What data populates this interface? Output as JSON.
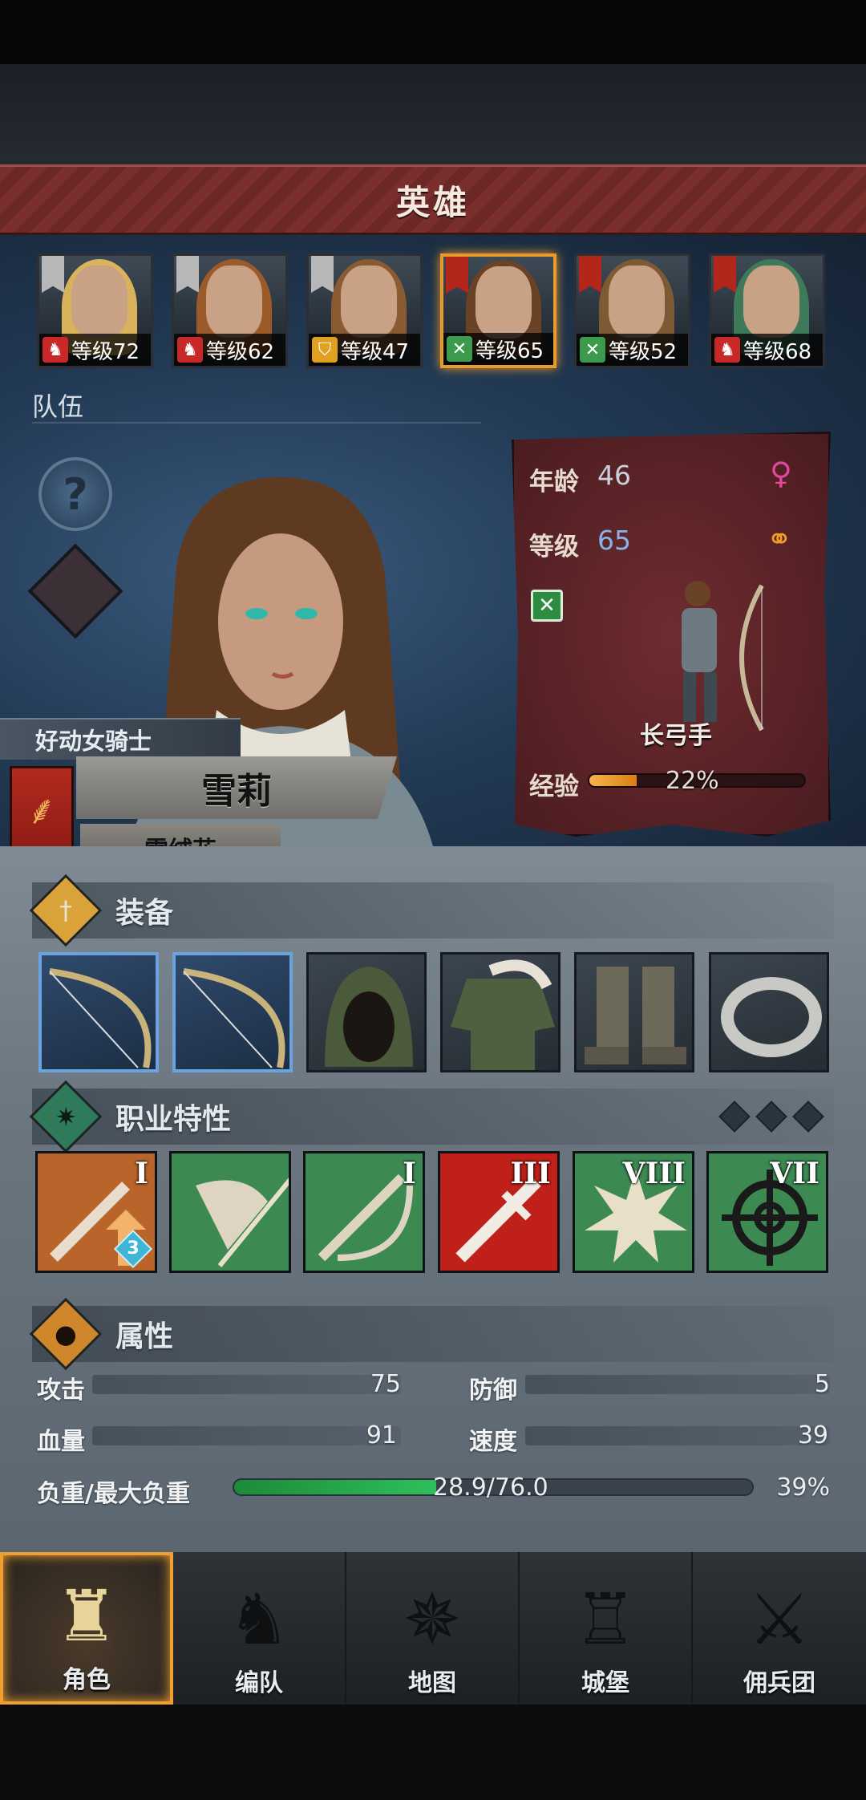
{
  "header": {
    "title": "英雄"
  },
  "heroes": [
    {
      "level_text": "等级72",
      "class_icon": "horse-icon",
      "flag": "grey-banner",
      "hair": "#d9b35c",
      "selected": false
    },
    {
      "level_text": "等级62",
      "class_icon": "horse-icon",
      "flag": "grey-banner",
      "hair": "#9a5a2a",
      "selected": false
    },
    {
      "level_text": "等级47",
      "class_icon": "shield-icon",
      "flag": "grey-banner",
      "hair": "#8a5a30",
      "selected": false
    },
    {
      "level_text": "等级65",
      "class_icon": "crossed-bows-icon",
      "flag": "red-banner",
      "hair": "#6a4226",
      "selected": true
    },
    {
      "level_text": "等级52",
      "class_icon": "crossed-bows-icon",
      "flag": "red-banner",
      "hair": "#7d5a34",
      "selected": false
    },
    {
      "level_text": "等级68",
      "class_icon": "horse-icon",
      "flag": "red-banner",
      "hair": "#3e7a5a",
      "selected": false
    }
  ],
  "team_label": "队伍",
  "hero": {
    "title": "好动女骑士",
    "name": "雪莉",
    "house": "雪绒花",
    "age_label": "年龄",
    "age": "46",
    "level_label": "等级",
    "level": "65",
    "class_name": "长弓手",
    "xp_label": "经验",
    "xp_percent_text": "22%",
    "xp_fraction": 0.22,
    "gender_icon": "female-icon",
    "status_icon": "rings-icon"
  },
  "sections": {
    "equipment": "装备",
    "traits": "职业特性",
    "attributes": "属性"
  },
  "equipment": [
    {
      "name": "longbow-icon",
      "highlight": true
    },
    {
      "name": "longbow-icon",
      "highlight": true
    },
    {
      "name": "hood-icon",
      "highlight": false
    },
    {
      "name": "fur-armor-icon",
      "highlight": false
    },
    {
      "name": "boots-icon",
      "highlight": false
    },
    {
      "name": "ring-icon",
      "highlight": false
    }
  ],
  "traits": [
    {
      "name": "sword-upgrade-icon",
      "rank": "I",
      "badge": "3",
      "color": "#b8642a"
    },
    {
      "name": "dodge-icon",
      "rank": "",
      "badge": "",
      "color": "#3c8a52"
    },
    {
      "name": "sword-bow-icon",
      "rank": "I",
      "badge": "",
      "color": "#3c8a52"
    },
    {
      "name": "sword-strike-icon",
      "rank": "III",
      "badge": "",
      "color": "#c0201a"
    },
    {
      "name": "burst-icon",
      "rank": "VIII",
      "badge": "",
      "color": "#3c8a52"
    },
    {
      "name": "target-icon",
      "rank": "VII",
      "badge": "",
      "color": "#3c8a52"
    }
  ],
  "attributes": {
    "attack_label": "攻击",
    "attack": "75",
    "defense_label": "防御",
    "defense": "5",
    "hp_label": "血量",
    "hp": "91",
    "speed_label": "速度",
    "speed": "39",
    "load_label": "负重/最大负重",
    "load_text": "28.9/76.0",
    "load_percent_text": "39%",
    "load_fraction": 0.39
  },
  "nav": [
    {
      "label": "角色",
      "icon": "knight-armor-icon",
      "active": true
    },
    {
      "label": "编队",
      "icon": "helmet-icon",
      "active": false
    },
    {
      "label": "地图",
      "icon": "compass-icon",
      "active": false
    },
    {
      "label": "城堡",
      "icon": "castle-icon",
      "active": false
    },
    {
      "label": "佣兵团",
      "icon": "mercenary-icon",
      "active": false
    }
  ],
  "colors": {
    "accent": "#e89a2a",
    "banner": "#7a2f2c",
    "xp": "#f6b54a",
    "load": "#2ec05a"
  }
}
